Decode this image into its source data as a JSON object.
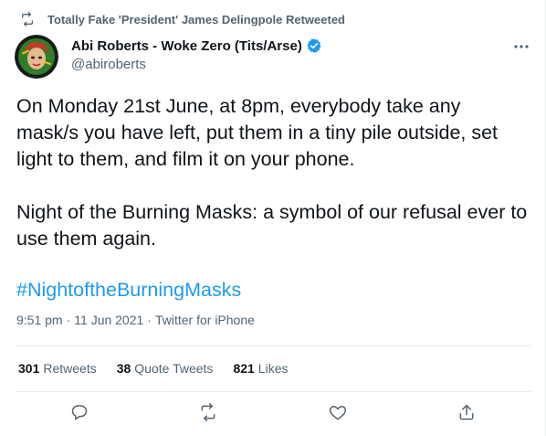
{
  "retweet_context": {
    "icon": "retweet-icon",
    "text": "Totally Fake 'President' James Delingpole Retweeted"
  },
  "author": {
    "display_name": "Abi Roberts - Woke Zero (Tits/Arse)",
    "verified_icon": "verified-badge-icon",
    "handle": "@abiroberts"
  },
  "tweet": {
    "paragraph1": "On Monday 21st June, at 8pm, everybody take any mask/s you have left, put them in a tiny pile outside, set light to them, and film it on your phone.",
    "paragraph2": "Night of the Burning Masks: a symbol of our refusal ever to use them again.",
    "hashtag": "#NightoftheBurningMasks"
  },
  "meta": {
    "time": "9:51 pm",
    "separator1": "·",
    "date": "11 Jun 2021",
    "separator2": "·",
    "source": "Twitter for iPhone"
  },
  "stats": {
    "retweets_count": "301",
    "retweets_label": "Retweets",
    "quotes_count": "38",
    "quotes_label": "Quote Tweets",
    "likes_count": "821",
    "likes_label": "Likes"
  },
  "actions": [
    "reply-icon",
    "retweet-icon",
    "like-icon",
    "share-icon"
  ],
  "colors": {
    "text": "#0f1419",
    "secondary": "#536471",
    "link": "#1d9bf0",
    "divider": "#e6ecf0"
  }
}
